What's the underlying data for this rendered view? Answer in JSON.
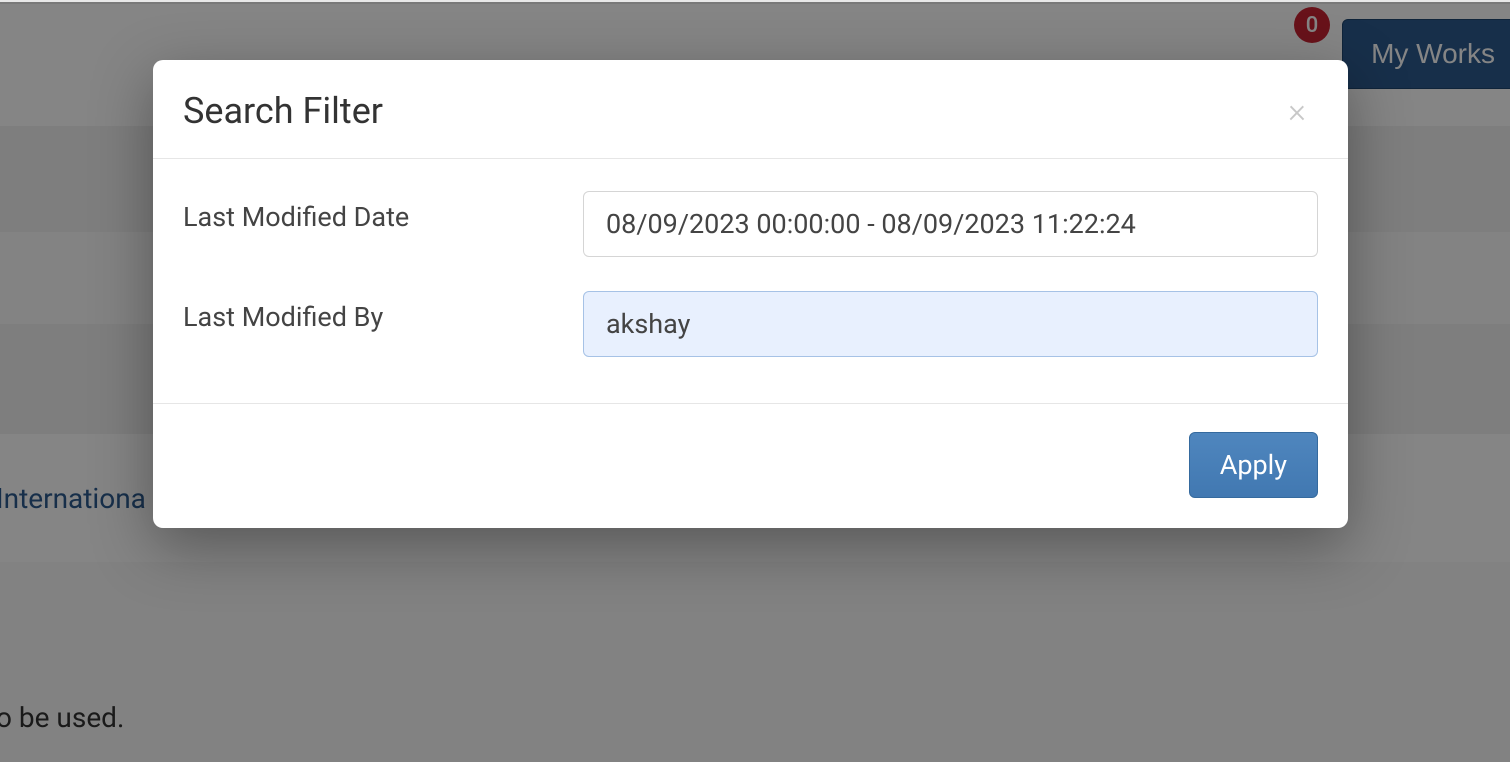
{
  "background": {
    "works_button_label": "My Works",
    "notification_count": "0",
    "link_text": "Internationa",
    "footer_fragment": "o be used."
  },
  "modal": {
    "title": "Search Filter",
    "close_label": "×",
    "fields": {
      "last_modified_date": {
        "label": "Last Modified Date",
        "value": "08/09/2023 00:00:00 - 08/09/2023 11:22:24"
      },
      "last_modified_by": {
        "label": "Last Modified By",
        "value": "akshay"
      }
    },
    "apply_button_label": "Apply"
  }
}
